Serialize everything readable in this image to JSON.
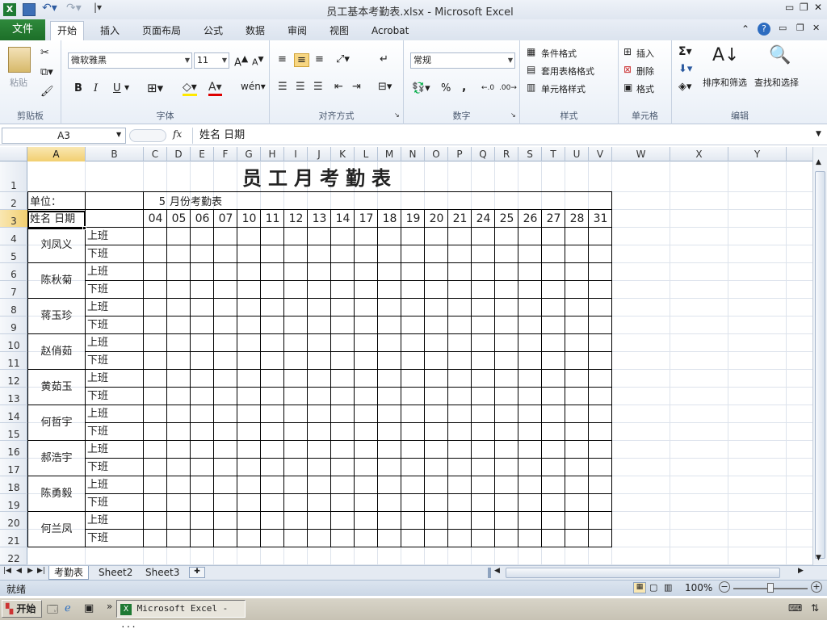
{
  "window": {
    "title": "员工基本考勤表.xlsx - Microsoft Excel"
  },
  "tabs": {
    "file": "文件",
    "home": "开始",
    "insert": "插入",
    "layout": "页面布局",
    "formulas": "公式",
    "data": "数据",
    "review": "审阅",
    "view": "视图",
    "acrobat": "Acrobat"
  },
  "ribbon": {
    "clipboard": {
      "label": "剪贴板",
      "paste": "粘贴"
    },
    "font": {
      "label": "字体",
      "family": "微软雅黑",
      "size": "11",
      "bold": "B",
      "italic": "I",
      "underline": "U"
    },
    "align": {
      "label": "对齐方式"
    },
    "number": {
      "label": "数字",
      "format": "常规",
      "percent": "%",
      "comma": ","
    },
    "styles": {
      "label": "样式",
      "conditional": "条件格式",
      "table": "套用表格格式",
      "cell": "单元格样式"
    },
    "cells": {
      "label": "单元格",
      "insert": "插入",
      "delete": "删除",
      "format": "格式"
    },
    "editing": {
      "label": "编辑",
      "sort": "排序和筛选",
      "find": "查找和选择"
    }
  },
  "formula_bar": {
    "name_box": "A3",
    "fx": "fx",
    "content": "姓名    日期"
  },
  "columns": [
    "A",
    "B",
    "C",
    "D",
    "E",
    "F",
    "G",
    "H",
    "I",
    "J",
    "K",
    "L",
    "M",
    "N",
    "O",
    "P",
    "Q",
    "R",
    "S",
    "T",
    "U",
    "V",
    "W",
    "X",
    "Y"
  ],
  "rows": [
    "1",
    "2",
    "3",
    "4",
    "5",
    "6",
    "7",
    "8",
    "9",
    "10",
    "11",
    "12",
    "13",
    "14",
    "15",
    "16",
    "17",
    "18",
    "19",
    "20",
    "21",
    "22"
  ],
  "sheet": {
    "title": "员工月考勤表",
    "unit_label": "单位：",
    "month": "5",
    "month_label": "月份考勤表",
    "name_date_header": "姓名  日期",
    "dates": [
      "04",
      "05",
      "06",
      "07",
      "10",
      "11",
      "12",
      "13",
      "14",
      "17",
      "18",
      "19",
      "20",
      "21",
      "24",
      "25",
      "26",
      "27",
      "28",
      "31"
    ],
    "shift_in": "上班",
    "shift_out": "下班",
    "employees": [
      "刘凤义",
      "陈秋菊",
      "蒋玉珍",
      "赵俏茹",
      "黄茹玉",
      "何哲宇",
      "郝浩宇",
      "陈勇毅",
      "何兰凤"
    ]
  },
  "sheet_tabs": [
    "考勤表",
    "Sheet2",
    "Sheet3"
  ],
  "status": {
    "ready": "就绪",
    "zoom": "100%"
  },
  "taskbar": {
    "start": "开始",
    "app": "Microsoft Excel - ..."
  }
}
